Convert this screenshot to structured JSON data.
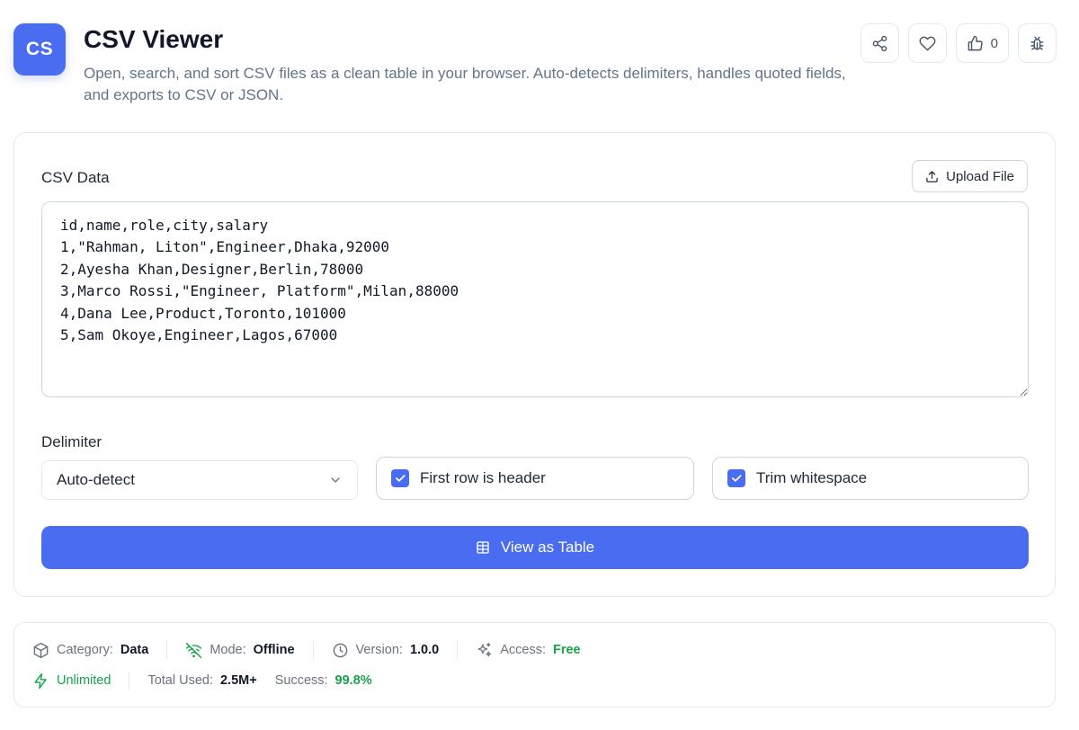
{
  "header": {
    "logo_text": "CS",
    "title": "CSV Viewer",
    "description": "Open, search, and sort CSV files as a clean table in your browser. Auto-detects delimiters, handles quoted fields, and exports to CSV or JSON.",
    "actions": [
      {
        "icon": "share-icon"
      },
      {
        "icon": "heart-icon"
      },
      {
        "icon": "thumbs-up-icon",
        "count": "0"
      },
      {
        "icon": "bug-icon"
      }
    ]
  },
  "form": {
    "csv_label": "CSV Data",
    "upload_label": "Upload File",
    "csv_value": "id,name,role,city,salary\n1,\"Rahman, Liton\",Engineer,Dhaka,92000\n2,Ayesha Khan,Designer,Berlin,78000\n3,Marco Rossi,\"Engineer, Platform\",Milan,88000\n4,Dana Lee,Product,Toronto,101000\n5,Sam Okoye,Engineer,Lagos,67000",
    "delimiter_label": "Delimiter",
    "delimiter_value": "Auto-detect",
    "first_row_header_label": "First row is header",
    "first_row_header_checked": true,
    "trim_whitespace_label": "Trim whitespace",
    "trim_whitespace_checked": true,
    "submit_label": "View as Table"
  },
  "meta": {
    "category_label": "Category:",
    "category_value": "Data",
    "mode_label": "Mode:",
    "mode_value": "Offline",
    "version_label": "Version:",
    "version_value": "1.0.0",
    "access_label": "Access:",
    "access_value": "Free",
    "unlimited_label": "Unlimited",
    "total_used_label": "Total Used:",
    "total_used_value": "2.5M+",
    "success_label": "Success:",
    "success_value": "99.8%"
  },
  "colors": {
    "accent": "#4a6cf0",
    "success": "#16a34a"
  }
}
